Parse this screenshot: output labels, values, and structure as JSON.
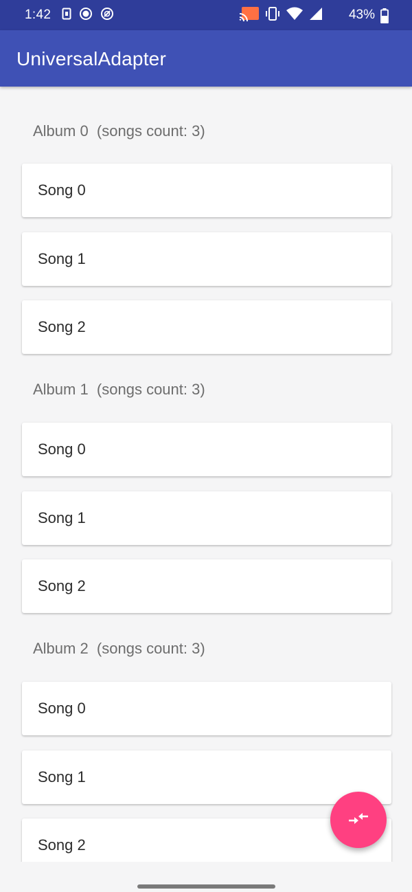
{
  "status_bar": {
    "time": "1:42",
    "battery_percent": "43%",
    "left_icons": [
      "sim-card-icon",
      "record-icon",
      "do-not-disturb-icon"
    ],
    "right_icons": [
      "cast-icon",
      "vibrate-icon",
      "wifi-icon",
      "cell-signal-icon",
      "battery-icon"
    ]
  },
  "app_bar": {
    "title": "UniversalAdapter"
  },
  "albums": [
    {
      "header": "Album 0  (songs count: 3)",
      "songs": [
        "Song 0",
        "Song 1",
        "Song 2"
      ]
    },
    {
      "header": "Album 1  (songs count: 3)",
      "songs": [
        "Song 0",
        "Song 1",
        "Song 2"
      ]
    },
    {
      "header": "Album 2  (songs count: 3)",
      "songs": [
        "Song 0",
        "Song 1",
        "Song 2"
      ]
    }
  ],
  "fab": {
    "icon": "compress-arrows-icon",
    "color": "#ff4081"
  },
  "colors": {
    "status_bar": "#2f3d9a",
    "app_bar": "#3f51b5",
    "background": "#f5f5f6"
  }
}
